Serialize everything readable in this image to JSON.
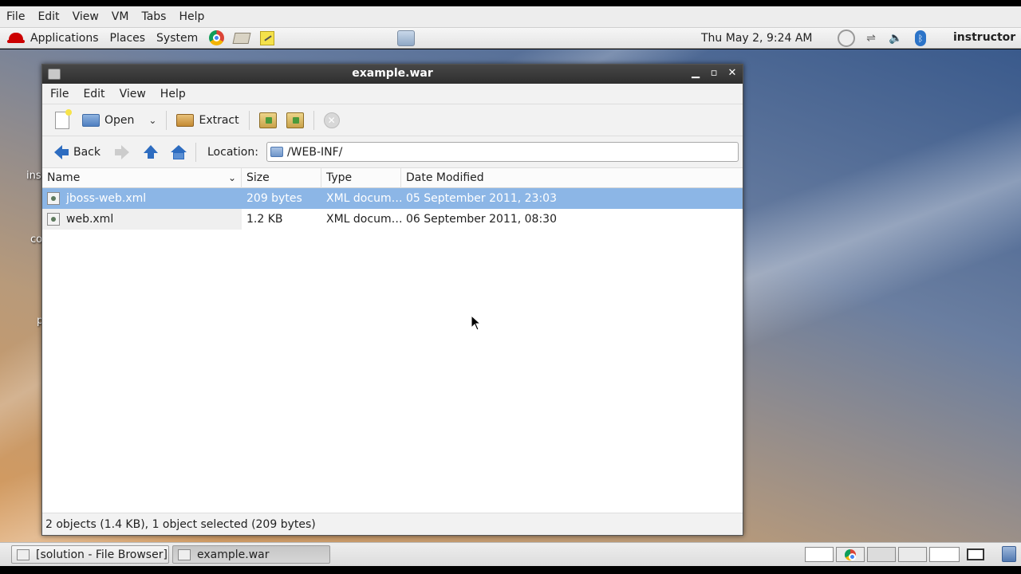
{
  "vm_menu": [
    "File",
    "Edit",
    "View",
    "VM",
    "Tabs",
    "Help"
  ],
  "top_panel": {
    "menus": [
      "Applications",
      "Places",
      "System"
    ],
    "clock": "Thu May  2,  9:24 AM",
    "user": "instructor"
  },
  "desktop_labels": [
    "ins",
    "co",
    "p"
  ],
  "window": {
    "title": "example.war",
    "menu": [
      "File",
      "Edit",
      "View",
      "Help"
    ],
    "toolbar": {
      "open_label": "Open",
      "extract_label": "Extract"
    },
    "location": {
      "back_label": "Back",
      "label": "Location:",
      "path": "/WEB-INF/"
    },
    "columns": [
      "Name",
      "Size",
      "Type",
      "Date Modified"
    ],
    "files": [
      {
        "name": "jboss-web.xml",
        "size": "209 bytes",
        "type": "XML docum…",
        "date": "05 September 2011, 23:03",
        "selected": true
      },
      {
        "name": "web.xml",
        "size": "1.2 KB",
        "type": "XML docum…",
        "date": "06 September 2011, 08:30",
        "selected": false
      }
    ],
    "status": "2 objects (1.4 KB), 1 object selected (209 bytes)"
  },
  "taskbar": {
    "tasks": [
      "[solution - File Browser]",
      "example.war"
    ]
  }
}
